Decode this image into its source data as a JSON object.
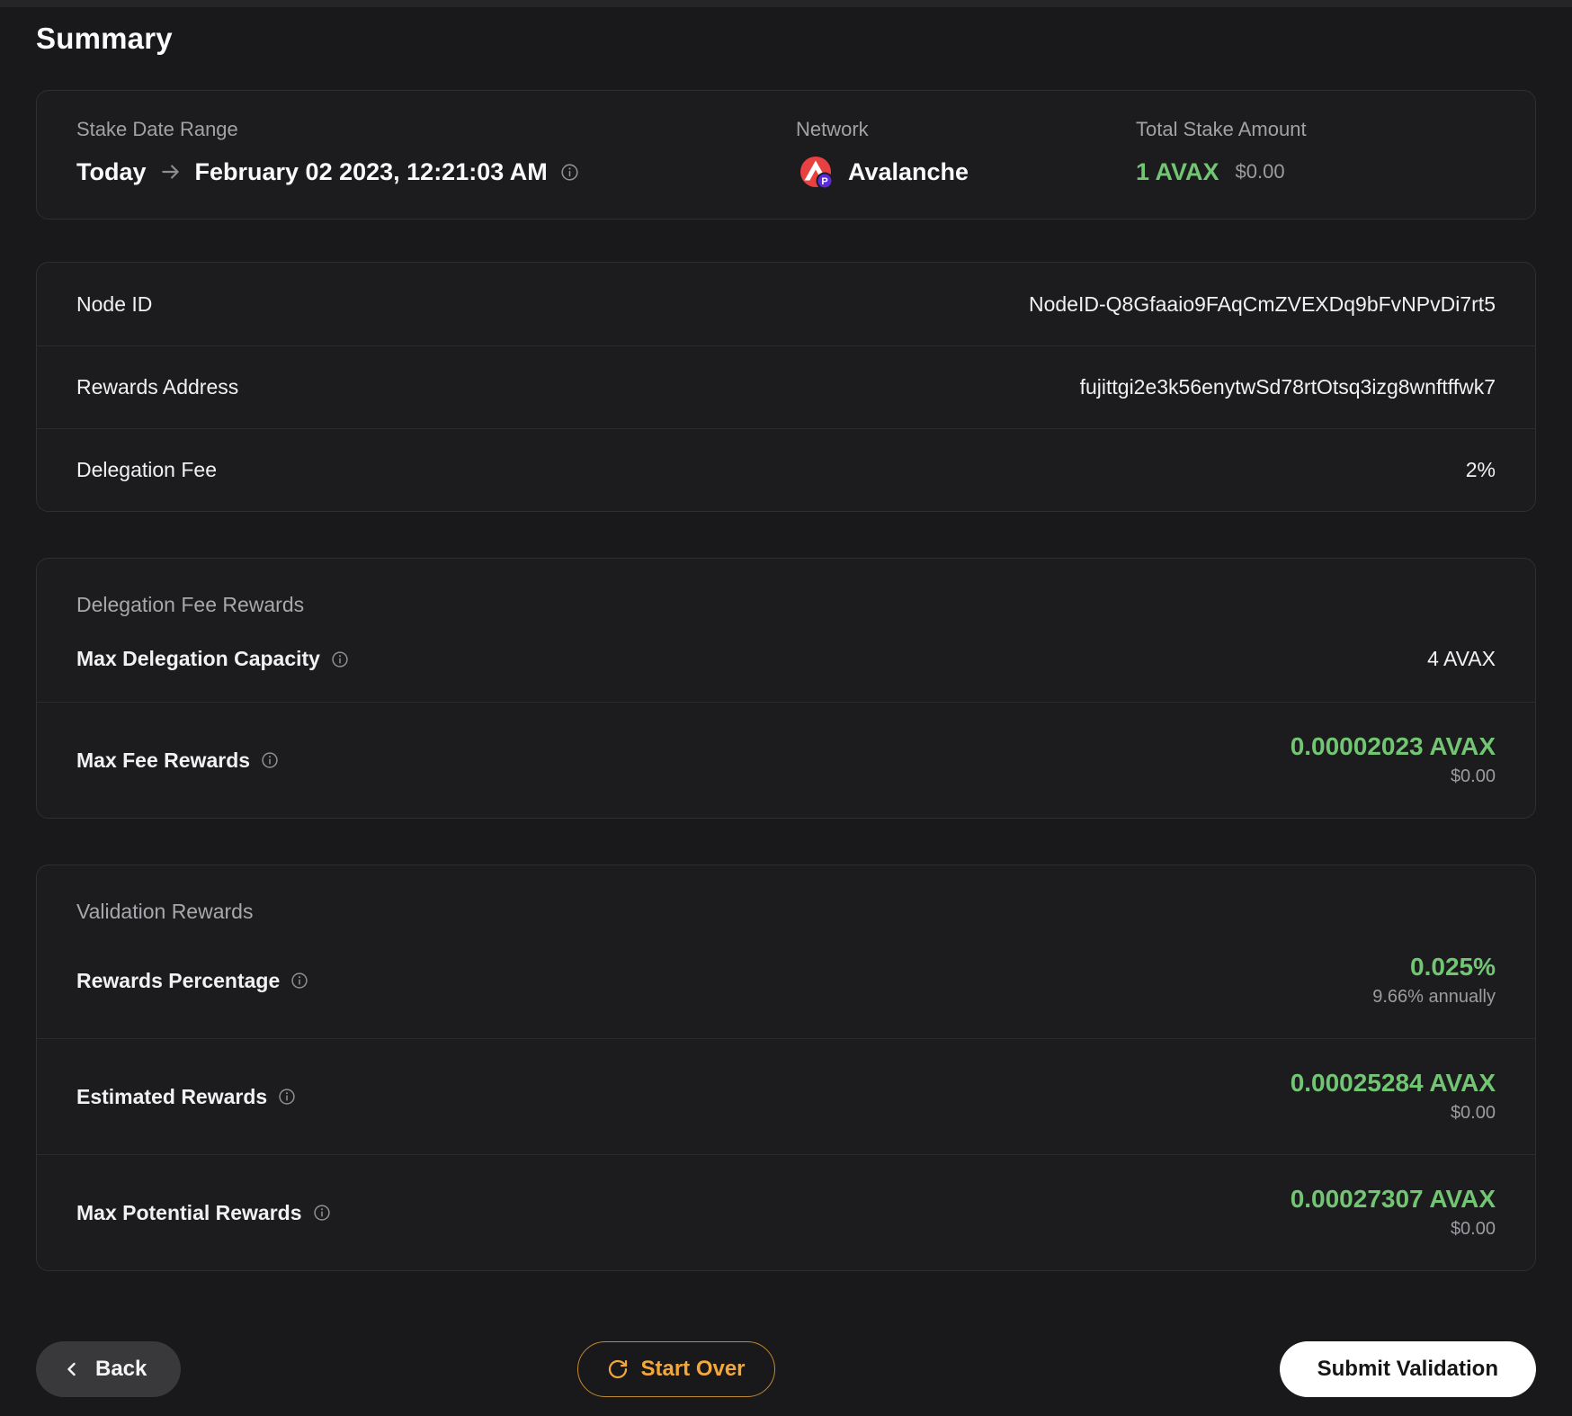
{
  "colors": {
    "green": "#72c573",
    "orange": "#f4a83a",
    "avalanche_red": "#e84142",
    "badge_purple": "#5b2bd9"
  },
  "page": {
    "title": "Summary"
  },
  "overview": {
    "stake_date_range": {
      "label": "Stake Date Range",
      "from": "Today",
      "to": "February 02 2023, 12:21:03 AM"
    },
    "network": {
      "label": "Network",
      "name": "Avalanche",
      "badge_letter": "P"
    },
    "total_stake": {
      "label": "Total Stake Amount",
      "amount": "1 AVAX",
      "usd": "$0.00"
    }
  },
  "node_details": {
    "rows": [
      {
        "label": "Node ID",
        "value": "NodeID-Q8Gfaaio9FAqCmZVEXDq9bFvNPvDi7rt5"
      },
      {
        "label": "Rewards Address",
        "value": "fujittgi2e3k56enytwSd78rtOtsq3izg8wnftffwk7"
      },
      {
        "label": "Delegation Fee",
        "value": "2%"
      }
    ]
  },
  "delegation_fee_rewards": {
    "title": "Delegation Fee Rewards",
    "max_delegation_capacity": {
      "label": "Max Delegation Capacity",
      "value": "4 AVAX"
    },
    "max_fee_rewards": {
      "label": "Max Fee Rewards",
      "value": "0.00002023 AVAX",
      "usd": "$0.00"
    }
  },
  "validation_rewards": {
    "title": "Validation Rewards",
    "rows": [
      {
        "label": "Rewards Percentage",
        "value": "0.025%",
        "sub": "9.66% annually"
      },
      {
        "label": "Estimated Rewards",
        "value": "0.00025284 AVAX",
        "sub": "$0.00"
      },
      {
        "label": "Max Potential Rewards",
        "value": "0.00027307 AVAX",
        "sub": "$0.00"
      }
    ]
  },
  "footer": {
    "back_label": "Back",
    "start_over_label": "Start Over",
    "submit_label": "Submit Validation"
  }
}
